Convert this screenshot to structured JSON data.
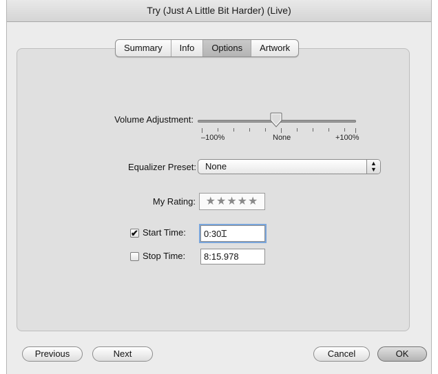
{
  "window": {
    "title": "Try (Just A Little Bit Harder) (Live)"
  },
  "tabs": [
    {
      "label": "Summary",
      "selected": false
    },
    {
      "label": "Info",
      "selected": false
    },
    {
      "label": "Options",
      "selected": true
    },
    {
      "label": "Artwork",
      "selected": false
    }
  ],
  "options": {
    "volume": {
      "label": "Volume Adjustment:",
      "value_percent": 0,
      "tick_labels": {
        "min": "–100%",
        "mid": "None",
        "max": "+100%"
      }
    },
    "equalizer": {
      "label": "Equalizer Preset:",
      "value": "None"
    },
    "rating": {
      "label": "My Rating:",
      "stars": "★★★★★",
      "value": 0
    },
    "start_time": {
      "label": "Start Time:",
      "checked": true,
      "value": "0:30"
    },
    "stop_time": {
      "label": "Stop Time:",
      "checked": false,
      "value": "8:15.978"
    }
  },
  "buttons": {
    "previous": "Previous",
    "next": "Next",
    "cancel": "Cancel",
    "ok": "OK"
  },
  "colors": {
    "window_bg": "#ececec",
    "panel_bg": "#e0e0e0",
    "focus_ring": "#7aa6dc"
  }
}
